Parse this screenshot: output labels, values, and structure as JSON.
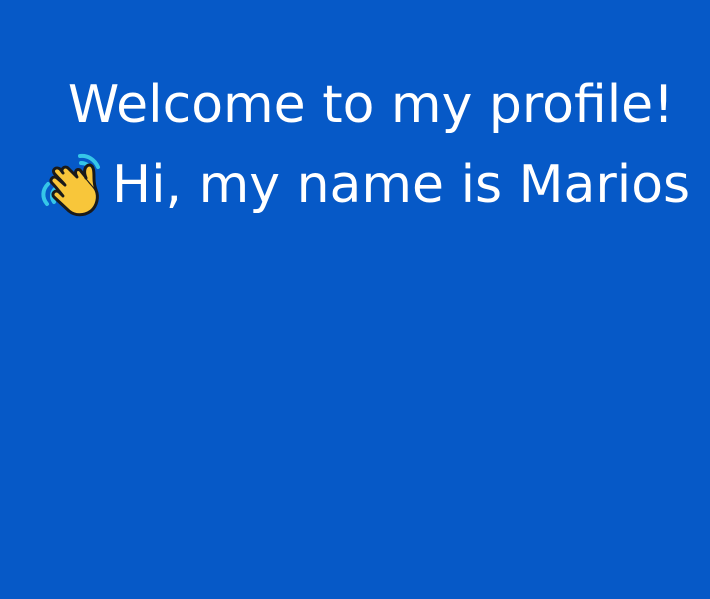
{
  "profile": {
    "title": "Welcome to my profile!",
    "greeting": "Hi, my name is Marios",
    "greeting_icon": "waving-hand-icon"
  },
  "colors": {
    "background": "#0659c7",
    "text": "#ffffff",
    "hand": "#f8c63a",
    "hand_outline": "#1a1a1a",
    "motion_lines": "#35c6e8"
  }
}
